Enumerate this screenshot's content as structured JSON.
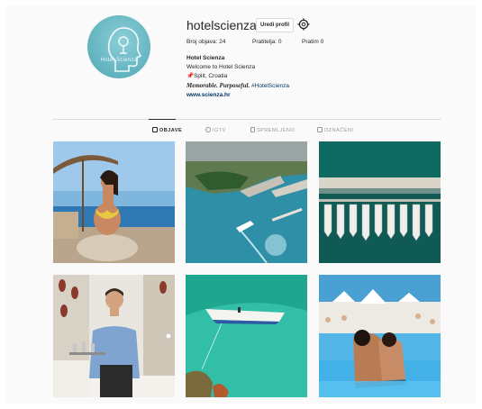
{
  "profile": {
    "username": "hotelscienza",
    "edit_label": "Uredi profil",
    "avatar_text": "Hotel Scienza",
    "stats": {
      "posts": "Broj objava: 24",
      "followers": "Pratitelja: 0",
      "following": "Pratim 0"
    },
    "bio": {
      "name": "Hotel Scienza",
      "line1": "Welcome to Hotel Scienza",
      "location": "Split, Croatia",
      "slogan": "Memorable. Purposeful.",
      "hashtag": "#HotelScienza",
      "website": "www.scienza.hr"
    }
  },
  "tabs": [
    {
      "label": "OBJAVE",
      "icon": "grid-icon",
      "active": true
    },
    {
      "label": "IGTV",
      "icon": "igtv-icon",
      "active": false
    },
    {
      "label": "SPREMLJENO",
      "icon": "bookmark-icon",
      "active": false
    },
    {
      "label": "OZNAČENI",
      "icon": "tagged-icon",
      "active": false
    }
  ],
  "posts": [
    {
      "subject": "woman in yellow bikini on beach"
    },
    {
      "subject": "aerial view of harbor with boats"
    },
    {
      "subject": "aerial view of yachts in marina"
    },
    {
      "subject": "waiter holding tray in restaurant"
    },
    {
      "subject": "boat on turquoise water"
    },
    {
      "subject": "two women in pool"
    }
  ],
  "colors": {
    "background": "#fafafa",
    "link": "#003569",
    "avatar": "#66b6c2",
    "border": "#dbdbdb"
  }
}
